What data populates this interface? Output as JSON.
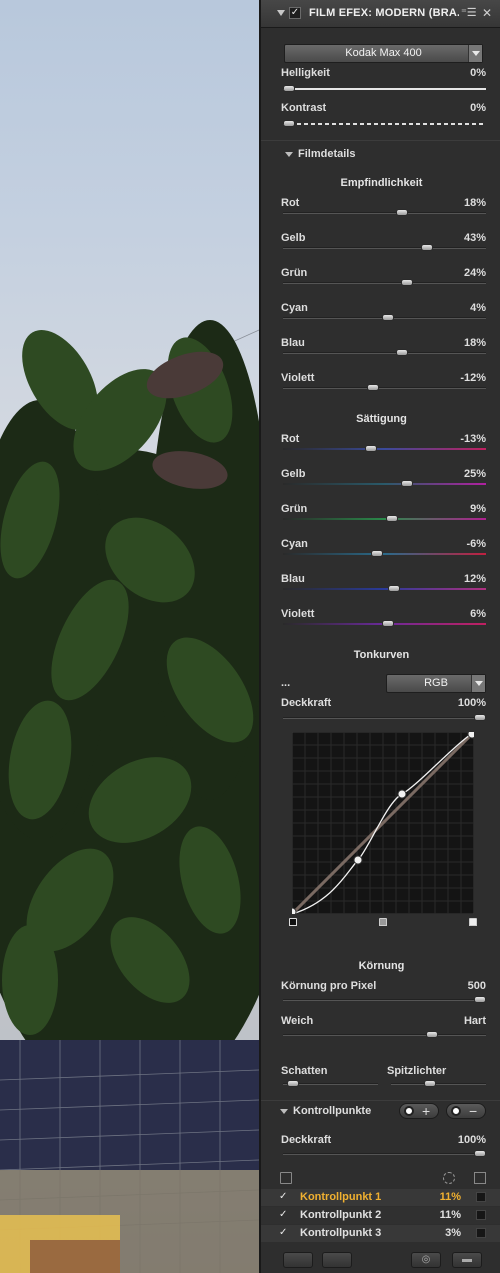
{
  "panel": {
    "title": "FILM EFEX: MODERN (BRA...",
    "preset": "Kodak Max 400",
    "menu_icon": "menu-icon",
    "close_icon": "close-icon"
  },
  "basic": {
    "brightness": {
      "label": "Helligkeit",
      "value": "0%",
      "level": 0.0
    },
    "contrast": {
      "label": "Kontrast",
      "value": "0%",
      "level": 0.0
    }
  },
  "film_details": {
    "section_label": "Filmdetails",
    "sensitivity": {
      "heading": "Empfindlichkeit",
      "items": [
        {
          "label": "Rot",
          "value": "18%",
          "level": 0.59
        },
        {
          "label": "Gelb",
          "value": "43%",
          "level": 0.72
        },
        {
          "label": "Grün",
          "value": "24%",
          "level": 0.62
        },
        {
          "label": "Cyan",
          "value": "4%",
          "level": 0.52
        },
        {
          "label": "Blau",
          "value": "18%",
          "level": 0.59
        },
        {
          "label": "Violett",
          "value": "-12%",
          "level": 0.44
        }
      ]
    },
    "saturation": {
      "heading": "Sättigung",
      "items": [
        {
          "label": "Rot",
          "value": "-13%",
          "level": 0.43,
          "colors": [
            "#2a2a2a",
            "#3a4a9a",
            "#c02060"
          ]
        },
        {
          "label": "Gelb",
          "value": "25%",
          "level": 0.62,
          "colors": [
            "#2a2a2a",
            "#2a5a6a",
            "#b020a0"
          ]
        },
        {
          "label": "Grün",
          "value": "9%",
          "level": 0.54,
          "colors": [
            "#2a2a2a",
            "#2a8a4a",
            "#b02090"
          ]
        },
        {
          "label": "Cyan",
          "value": "-6%",
          "level": 0.46,
          "colors": [
            "#2a2a2a",
            "#2a6a8a",
            "#c02040"
          ]
        },
        {
          "label": "Blau",
          "value": "12%",
          "level": 0.55,
          "colors": [
            "#2a2a2a",
            "#2a3a9a",
            "#b03080"
          ]
        },
        {
          "label": "Violett",
          "value": "6%",
          "level": 0.52,
          "colors": [
            "#2a2a2a",
            "#6a2a9a",
            "#c02060"
          ]
        }
      ]
    },
    "tone_curves": {
      "heading": "Tonkurven",
      "more_label": "...",
      "channel": "RGB",
      "opacity": {
        "label": "Deckkraft",
        "value": "100%",
        "level": 1.0
      }
    },
    "grain": {
      "heading": "Körnung",
      "per_pixel": {
        "label": "Körnung pro Pixel",
        "value": "500",
        "level": 1.0
      },
      "soft_label": "Weich",
      "hard_label": "Hart",
      "softness_level": 0.75,
      "shadows": {
        "label": "Schatten",
        "level": 0.05
      },
      "highlights": {
        "label": "Spitzlichter",
        "level": 0.4
      }
    }
  },
  "control_points": {
    "section_label": "Kontrollpunkte",
    "opacity": {
      "label": "Deckkraft",
      "value": "100%",
      "level": 1.0
    },
    "items": [
      {
        "check": "✓",
        "name": "Kontrollpunkt 1",
        "value": "11%",
        "selected": true
      },
      {
        "check": "✓",
        "name": "Kontrollpunkt 2",
        "value": "11%",
        "selected": false
      },
      {
        "check": "✓",
        "name": "Kontrollpunkt 3",
        "value": "3%",
        "selected": false
      }
    ],
    "add_symbol": "+",
    "remove_symbol": "−"
  },
  "colors": {
    "accent": "#f0b030",
    "panel_bg": "#2e2e2e",
    "curve_bg": "#141414"
  }
}
